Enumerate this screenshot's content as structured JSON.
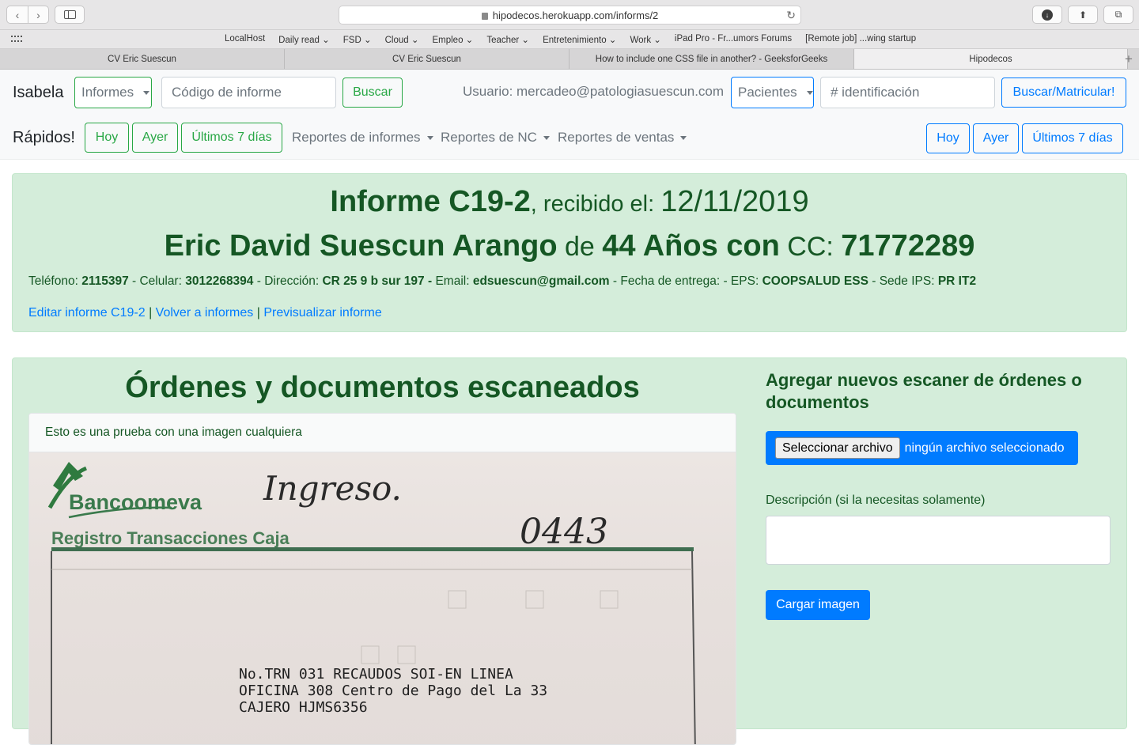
{
  "browser": {
    "url": "hipodecos.herokuapp.com/informs/2",
    "favorites": [
      "LocalHost",
      "Daily read ⌄",
      "FSD ⌄",
      "Cloud ⌄",
      "Empleo ⌄",
      "Teacher ⌄",
      "Entretenimiento ⌄",
      "Work ⌄",
      "iPad Pro - Fr...umors Forums",
      "[Remote job] ...wing startup"
    ],
    "tabs": [
      "CV Eric Suescun",
      "CV Eric Suescun",
      "How to include one CSS file in another? - GeeksforGeeks",
      "Hipodecos"
    ]
  },
  "nav": {
    "brand": "Isabela",
    "informes_select": "Informes",
    "codigo_placeholder": "Código de informe",
    "buscar": "Buscar",
    "usuario": "Usuario: mercadeo@patologiasuescun.com",
    "pacientes_select": "Pacientes",
    "identificacion_placeholder": "# identificación",
    "buscar_matricular": "Buscar/Matricular!",
    "rapidos": "Rápidos!",
    "hoy": "Hoy",
    "ayer": "Ayer",
    "ultimos": "Últimos 7 días",
    "reportes_informes": "Reportes de informes",
    "reportes_nc": "Reportes de NC",
    "reportes_ventas": "Reportes de ventas",
    "hoy_r": "Hoy",
    "ayer_r": "Ayer",
    "ultimos_r": "Últimos 7 días"
  },
  "informe": {
    "titulo_bold": "Informe C19-2",
    "recibido": ", recibido el: ",
    "fecha": "12/11/2019",
    "paciente": "Eric David Suescun Arango",
    "de": " de ",
    "edad": "44 Años con",
    "cc_label": " CC: ",
    "cc": "71772289",
    "telefono_label": "Teléfono: ",
    "telefono": "2115397",
    "celular_label": " - Celular: ",
    "celular": "3012268394",
    "direccion_label": " - Dirección: ",
    "direccion": "CR 25 9 b sur 197 -",
    "email_label": " Email: ",
    "email": "edsuescun@gmail.com",
    "entrega_label": " - Fecha de entrega: - EPS: ",
    "eps": "COOPSALUD ESS",
    "sede_label": " - Sede IPS: ",
    "sede": "PR IT2",
    "link_editar": "Editar informe C19-2",
    "sep": " | ",
    "link_volver": "Volver a informes",
    "link_previsualizar": "Previsualizar informe"
  },
  "documentos": {
    "titulo": "Órdenes y documentos escaneados",
    "descripcion_doc": "Esto es una prueba con una imagen cualquiera",
    "scan": {
      "logo": "Bancoomeva",
      "registro": "Registro Transacciones Caja",
      "handwritten_1": "Ingreso.",
      "handwritten_2": "0443",
      "line1": "No.TRN 031   RECAUDOS SOI-EN LINEA",
      "line2": "OFICINA    308  Centro de Pago del La 33",
      "line3": "CAJERO     HJMS6356"
    },
    "agregar_titulo": "Agregar nuevos escaner de órdenes o documentos",
    "seleccionar": "Seleccionar archivo",
    "ningun": "ningún archivo seleccionado",
    "descripcion_label": "Descripción (si la necesitas solamente)",
    "cargar": "Cargar imagen"
  }
}
